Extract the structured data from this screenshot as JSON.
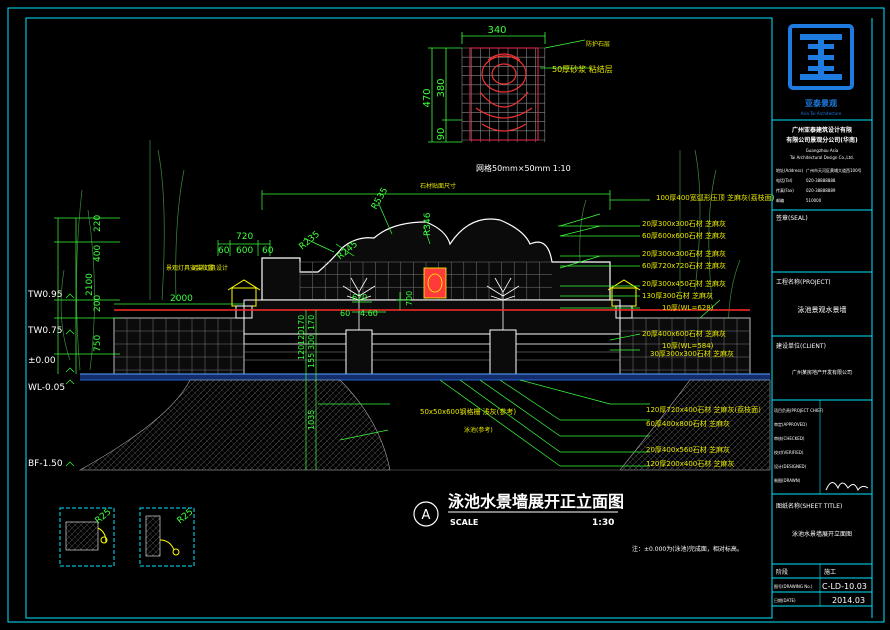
{
  "colors": {
    "background": "#000000",
    "frame": "#00e5ff",
    "dimension": "#3dff3d",
    "leader_text": "#e8e800",
    "wall": "#ffffff",
    "water_line": "#2f7fff",
    "red_line": "#ff2a2a",
    "logo": "#1e7ce0"
  },
  "icons": {
    "company_logo": "grid-seal-logo-icon",
    "section_marker": "circle-a-marker-icon",
    "signature": "handwritten-signature"
  },
  "drawing": {
    "title": "泳池水景墙展开正立面图",
    "scale_label": "SCALE",
    "scale_value": "1:30",
    "marker": "A",
    "note": "注：±0.000为(泳池)完成面，相对标高。",
    "detail_dims": {
      "width": "340",
      "height_total": "470",
      "height_a": "380",
      "height_b": "90",
      "callout_1": "防护石层",
      "callout_2": "50厚砂浆  粘结层",
      "caption": "网格50mm×50mm 1:10"
    },
    "levels": [
      {
        "label": "TW0.95"
      },
      {
        "label": "TW0.75"
      },
      {
        "label": "±0.00"
      },
      {
        "label": "WL-0.05"
      },
      {
        "label": "BF-1.50"
      }
    ],
    "top_dims": [
      "720",
      "60",
      "600",
      "60",
      "2000"
    ],
    "vert_dims": [
      "220",
      "400",
      "2100",
      "200",
      "750"
    ],
    "center_vert_dims": [
      "170",
      "120",
      "120",
      "170",
      "300",
      "155",
      "1035"
    ],
    "arc_dims": [
      "R235",
      "R535",
      "R346",
      "R245"
    ],
    "inner_dims": [
      "620",
      "60",
      "4.60",
      "700"
    ],
    "left_notes": [
      "景观灯具安装位置",
      "另详灯具设计"
    ],
    "top_note": "石材贴面尺寸",
    "right_labels": [
      "100厚400宽弧形压顶  芝麻灰(荔枝面)",
      "20厚300x300石材  芝麻灰",
      "60厚600x600石材  芝麻灰",
      "20厚300x300石材  芝麻灰",
      "60厚720x720石材  芝麻灰",
      "20厚300x450石材  芝麻灰",
      "130厚300石材  芝麻灰",
      "10厚(WL=628)",
      "20厚400x600石材  芝麻灰",
      "10厚(WL=584)",
      "30厚300x300石材  芝麻灰"
    ],
    "bottom_labels": [
      "50x50x600钢格栅  浅灰(参考)",
      "120厚720x400石材  芝麻灰(荔枝面)",
      "60厚400x800石材  芝麻灰",
      "20厚400x560石材  芝麻灰",
      "120厚200x400石材  芝麻灰"
    ],
    "bottom_sub_note": "泳池(参考)",
    "detail_radius_1": "R25",
    "detail_radius_2": "R25"
  },
  "title_block": {
    "logo_name": "亚泰景观",
    "logo_subtitle": "Asia Tai Architecture",
    "company_line_1": "广州亚泰建筑设计有限",
    "company_line_2": "有限公司景观分公司(华南)",
    "company_en_1": "Guangzhou Asia",
    "company_en_2": "Tai Architectural Design Co.,Ltd.",
    "addr_label": "地址(Address)",
    "addr_value": "广州市天河区黄埔大道西100号",
    "tel_label": "电话(Tel)",
    "tel_value": "020-38888888",
    "fax_label": "传真(Fax)",
    "fax_value": "020-38888889",
    "code_label": "邮编",
    "code_value": "510000",
    "seal_label": "签章(SEAL)",
    "project_label": "工程名称(PROJECT)",
    "project_value": "泳池景观水景墙",
    "client_label": "建设单位(CLIENT)",
    "client_value": "广州某房地产开发有限公司",
    "roles": [
      {
        "label": "项目负责(PROJECT CHIEF)",
        "value": ""
      },
      {
        "label": "审定(APPROVED)",
        "value": ""
      },
      {
        "label": "审核(CHECKED)",
        "value": ""
      },
      {
        "label": "校对(VERIFIED)",
        "value": ""
      },
      {
        "label": "设计(DESIGNED)",
        "value": ""
      },
      {
        "label": "制图(DRAWN)",
        "value": ""
      }
    ],
    "sheet_title_label": "图纸名称(SHEET TITLE)",
    "sheet_title_value": "泳池水景墙展开立面图",
    "phase_label": "阶段",
    "phase_value": "施工",
    "number_label": "图号(DRAWING No.)",
    "number_value": "C-LD-10.03",
    "date_label": "日期(DATE)",
    "date_value": "2014.03"
  }
}
